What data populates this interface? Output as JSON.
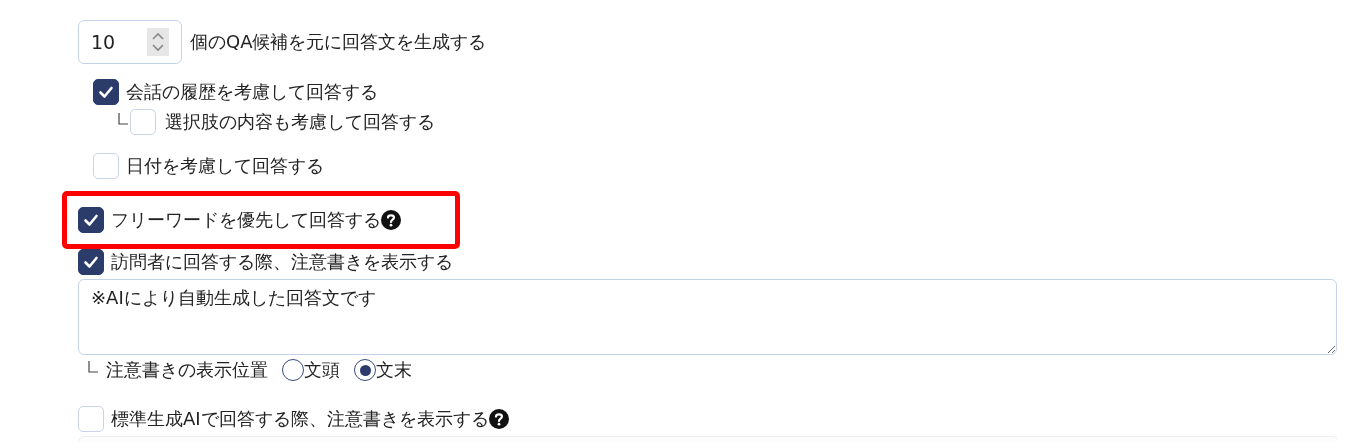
{
  "answer_count": {
    "value": "10",
    "label": "個のQA候補を元に回答文を生成する"
  },
  "context_options": [
    {
      "label": "会話の履歴を考慮して回答する",
      "checked": true,
      "children": [
        {
          "label": "選択肢の内容も考慮して回答する",
          "checked": false
        }
      ]
    },
    {
      "label": "日付を考慮して回答する",
      "checked": false
    }
  ],
  "options": [
    {
      "label": "フリーワードを優先して回答する",
      "checked": true,
      "help": true,
      "highlighted": true
    },
    {
      "label": "訪問者に回答する際、注意書きを表示する",
      "checked": true,
      "notice": {
        "value": "※AIにより自動生成した回答文です",
        "position_label": "注意書きの表示位置",
        "positions": [
          {
            "label": "文頭",
            "selected": false
          },
          {
            "label": "文末",
            "selected": true
          }
        ]
      }
    },
    {
      "label": "標準生成AIで回答する際、注意書きを表示する",
      "checked": false,
      "help": true,
      "field_below": true
    }
  ]
}
